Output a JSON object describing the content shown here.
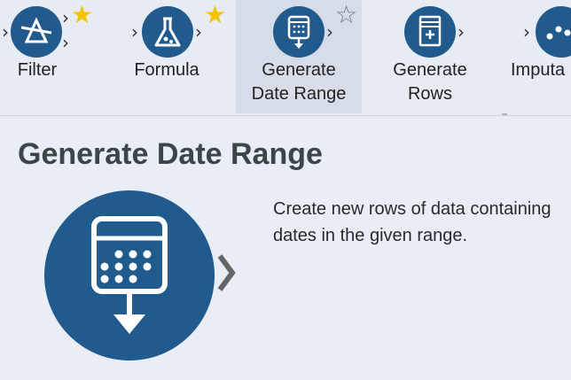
{
  "toolbar": {
    "tools": [
      {
        "label": "Filter",
        "icon": "filter-icon",
        "favorite": true
      },
      {
        "label": "Formula",
        "icon": "formula-flask-icon",
        "favorite": true
      },
      {
        "label": "Generate\nDate Range",
        "icon": "calendar-download-icon",
        "favorite": false,
        "selected": true
      },
      {
        "label": "Generate\nRows",
        "icon": "generate-rows-icon",
        "favorite": false
      },
      {
        "label": "Imputa",
        "icon": "imputation-icon",
        "favorite": false
      }
    ],
    "star_filled_color": "#f5c400",
    "star_outline_color": "#6b7b8b",
    "icon_color": "#215a8c"
  },
  "detail": {
    "title": "Generate Date Range",
    "description": "Create new rows of data containing dates in the given range.",
    "icon": "calendar-download-icon"
  }
}
